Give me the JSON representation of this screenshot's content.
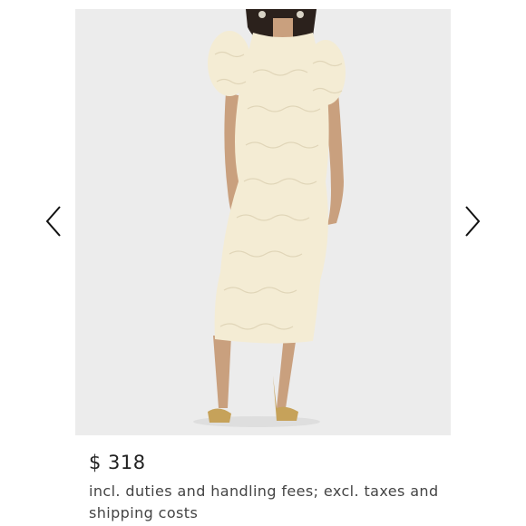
{
  "product": {
    "image_alt": "",
    "price": "$ 318",
    "note": "incl. duties and handling fees; excl. taxes and shipping costs"
  },
  "carousel": {
    "prev_icon": "chevron-left-icon",
    "next_icon": "chevron-right-icon"
  },
  "colors": {
    "photo_background": "#ececec",
    "dress": "#f4ecd4",
    "skin": "#c9a07e",
    "hair": "#2b211c",
    "sandals": "#c6a25a",
    "price_text": "#222222",
    "note_text": "#444444"
  }
}
